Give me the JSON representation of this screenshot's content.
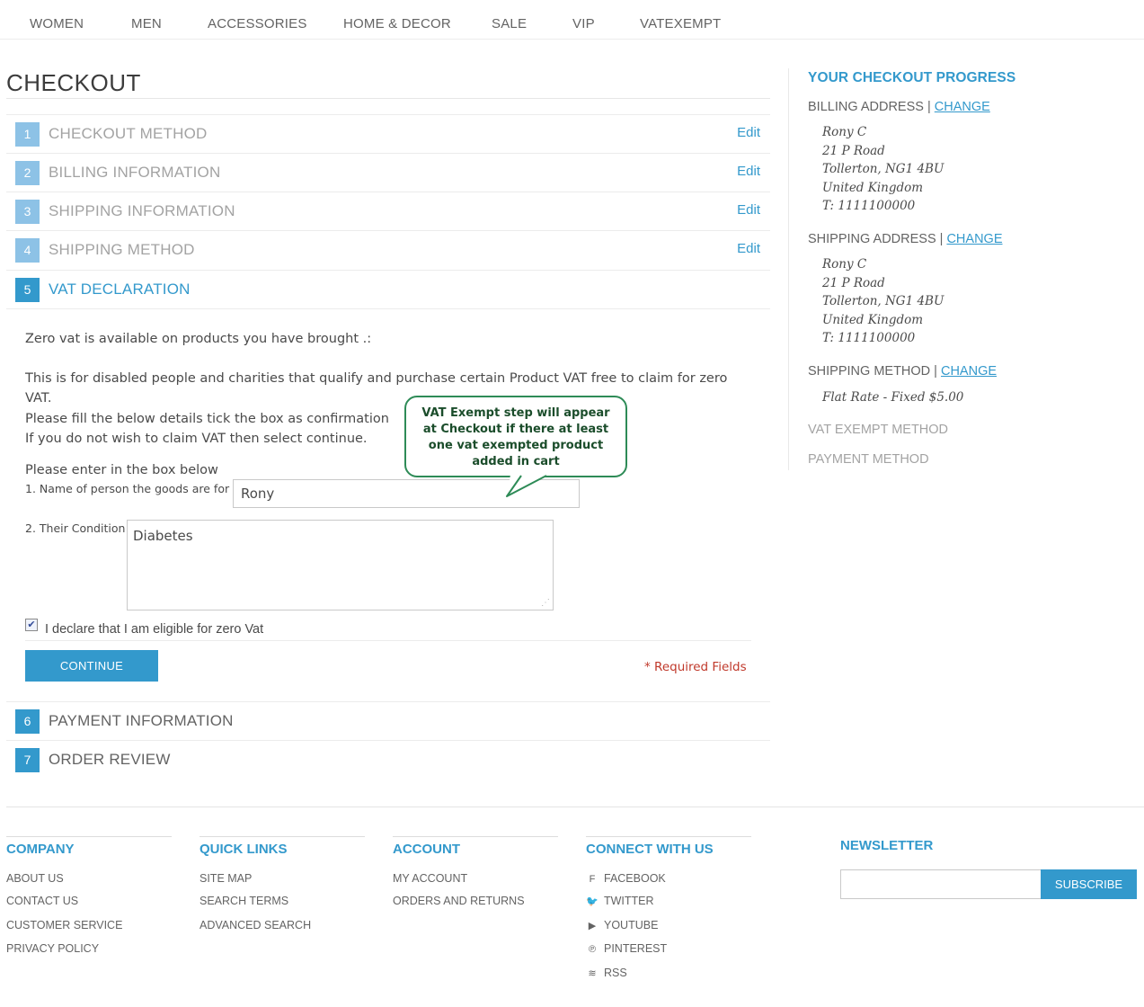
{
  "topnav": [
    "WOMEN",
    "MEN",
    "ACCESSORIES",
    "HOME & DECOR",
    "SALE",
    "VIP",
    "VATEXEMPT"
  ],
  "page_title": "CHECKOUT",
  "steps": [
    {
      "num": "1",
      "label": "CHECKOUT METHOD",
      "edit": "Edit"
    },
    {
      "num": "2",
      "label": "BILLING INFORMATION",
      "edit": "Edit"
    },
    {
      "num": "3",
      "label": "SHIPPING INFORMATION",
      "edit": "Edit"
    },
    {
      "num": "4",
      "label": "SHIPPING METHOD",
      "edit": "Edit"
    },
    {
      "num": "5",
      "label": "VAT DECLARATION"
    },
    {
      "num": "6",
      "label": "PAYMENT INFORMATION"
    },
    {
      "num": "7",
      "label": "ORDER REVIEW"
    }
  ],
  "vat": {
    "intro": "Zero vat is available on products you have brought .:",
    "desc1": "This is for disabled people and charities that qualify and purchase certain Product VAT free to claim for zero VAT.",
    "desc2": "Please fill the below details tick the box as confirmation",
    "desc3": "If you do not wish to claim VAT then select continue.",
    "enter_prompt": "Please enter in the box below",
    "name_label": "1. Name of person the goods are for",
    "name_value": "Rony",
    "condition_label": "2. Their Condition",
    "condition_value": "Diabetes",
    "declare_label": "I declare that I am eligible for zero Vat",
    "declare_checked": true,
    "continue_label": "CONTINUE",
    "required": "* Required Fields"
  },
  "callout": {
    "line1": "VAT Exempt step will appear",
    "line2": "at Checkout if there at least",
    "line3": "one vat exempted product",
    "line4": "added in cart",
    "color": "#2e8b57"
  },
  "sidebar": {
    "title": "YOUR CHECKOUT PROGRESS",
    "billing_heading": "BILLING ADDRESS",
    "shipping_heading": "SHIPPING ADDRESS",
    "method_heading": "SHIPPING METHOD",
    "change": "CHANGE",
    "separator": " | ",
    "billing": [
      "Rony C",
      "21 P Road",
      "Tollerton, NG1 4BU",
      "United Kingdom",
      "T: 1111100000"
    ],
    "shipping": [
      "Rony C",
      "21 P Road",
      "Tollerton, NG1 4BU",
      "United Kingdom",
      "T: 1111100000"
    ],
    "method_value": "Flat Rate - Fixed $5.00",
    "vat_method": "VAT EXEMPT METHOD",
    "payment_method": "PAYMENT METHOD"
  },
  "footer": {
    "company": {
      "title": "COMPANY",
      "links": [
        "ABOUT US",
        "CONTACT US",
        "CUSTOMER SERVICE",
        "PRIVACY POLICY"
      ]
    },
    "quick": {
      "title": "QUICK LINKS",
      "links": [
        "SITE MAP",
        "SEARCH TERMS",
        "ADVANCED SEARCH"
      ]
    },
    "account": {
      "title": "ACCOUNT",
      "links": [
        "MY ACCOUNT",
        "ORDERS AND RETURNS"
      ]
    },
    "connect": {
      "title": "CONNECT WITH US",
      "links": [
        {
          "icon": "facebook-icon",
          "glyph": "f",
          "label": "FACEBOOK"
        },
        {
          "icon": "twitter-icon",
          "glyph": "🐦",
          "label": "TWITTER"
        },
        {
          "icon": "youtube-icon",
          "glyph": "▶",
          "label": "YOUTUBE"
        },
        {
          "icon": "pinterest-icon",
          "glyph": "℗",
          "label": "PINTEREST"
        },
        {
          "icon": "rss-icon",
          "glyph": "≋",
          "label": "RSS"
        }
      ]
    },
    "newsletter": {
      "title": "NEWSLETTER",
      "button": "SUBSCRIBE",
      "input_value": ""
    }
  },
  "colors": {
    "accent": "#3399cc",
    "step_light": "#8dc2e6",
    "required": "#c0392b"
  }
}
